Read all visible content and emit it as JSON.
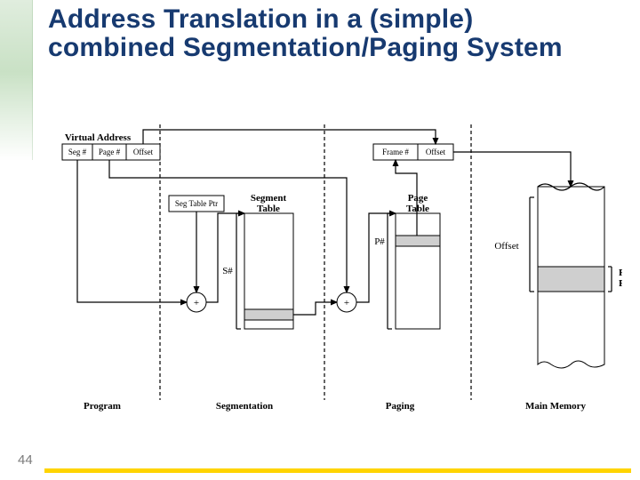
{
  "title": "Address Translation in a (simple) combined Segmentation/Paging System",
  "page_number": "44",
  "diagram": {
    "virtual_address_label": "Virtual Address",
    "va_fields": {
      "seg": "Seg #",
      "page": "Page #",
      "offset": "Offset"
    },
    "seg_table_ptr": "Seg Table Ptr",
    "segment_table": "Segment\nTable",
    "page_table": "Page\nTable",
    "phys_fields": {
      "frame": "Frame #",
      "offset": "Offset"
    },
    "s_hash": "S#",
    "p_hash": "P#",
    "offset_mem": "Offset",
    "page_frame": "Page\nFrame",
    "plus": "+",
    "sections": {
      "program": "Program",
      "segmentation": "Segmentation",
      "paging": "Paging",
      "main_memory": "Main Memory"
    }
  }
}
